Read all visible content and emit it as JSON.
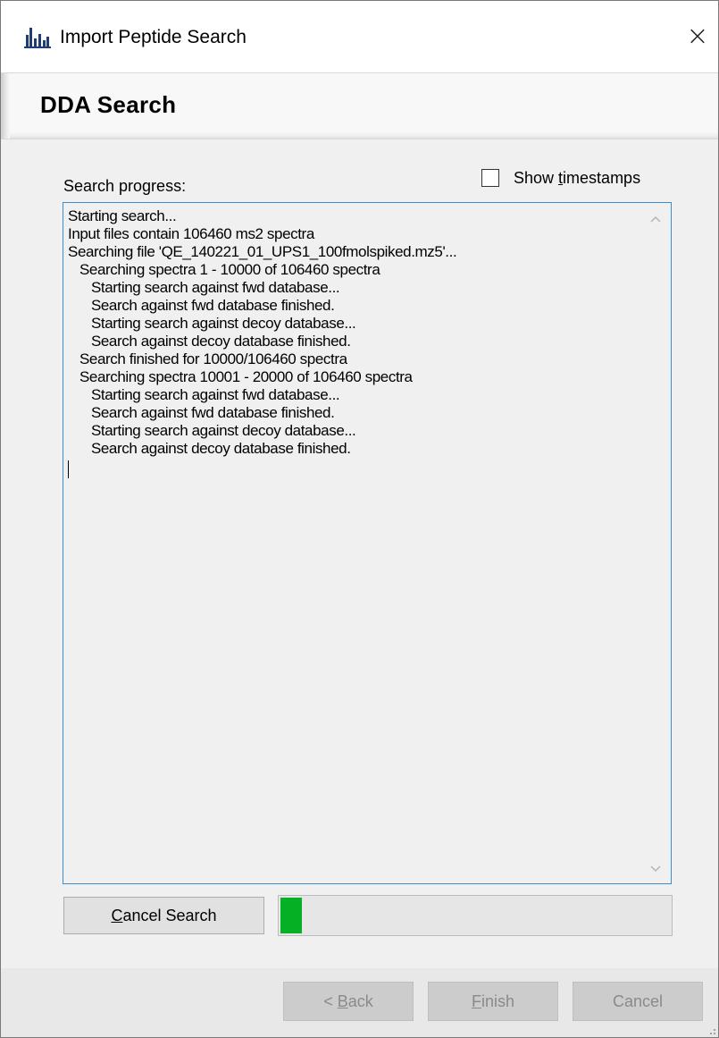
{
  "window": {
    "title": "Import Peptide Search",
    "close_label": "×"
  },
  "header": {
    "page_title": "DDA Search"
  },
  "progress": {
    "label": "Search progress:",
    "show_timestamps": {
      "label_prefix": "Show ",
      "label_mnemonic": "t",
      "label_suffix": "imestamps",
      "checked": false
    },
    "log_lines": [
      "Starting search...",
      "Input files contain 106460 ms2 spectra",
      "Searching file 'QE_140221_01_UPS1_100fmolspiked.mz5'...",
      "   Searching spectra 1 - 10000 of 106460 spectra",
      "      Starting search against fwd database...",
      "      Search against fwd database finished.",
      "      Starting search against decoy database...",
      "      Search against decoy database finished.",
      "   Search finished for 10000/106460 spectra",
      "   Searching spectra 10001 - 20000 of 106460 spectra",
      "      Starting search against fwd database...",
      "      Search against fwd database finished.",
      "      Starting search against decoy database...",
      "      Search against decoy database finished."
    ],
    "cancel_search": {
      "mnemonic": "C",
      "rest": "ancel Search"
    },
    "progress_fraction": 0.055
  },
  "footer": {
    "back": {
      "prefix": "< ",
      "mnemonic": "B",
      "rest": "ack"
    },
    "finish": {
      "mnemonic": "F",
      "rest": "inish"
    },
    "cancel": "Cancel"
  },
  "icons": {
    "app": "skyline-peak-icon",
    "close": "close-icon",
    "scroll_up": "chevron-up-icon",
    "scroll_down": "chevron-down-icon",
    "grip": "resize-grip-icon"
  },
  "colors": {
    "progress_fill": "#06b025",
    "log_border": "#3c8dd0",
    "app_icon": "#1f3c73"
  }
}
